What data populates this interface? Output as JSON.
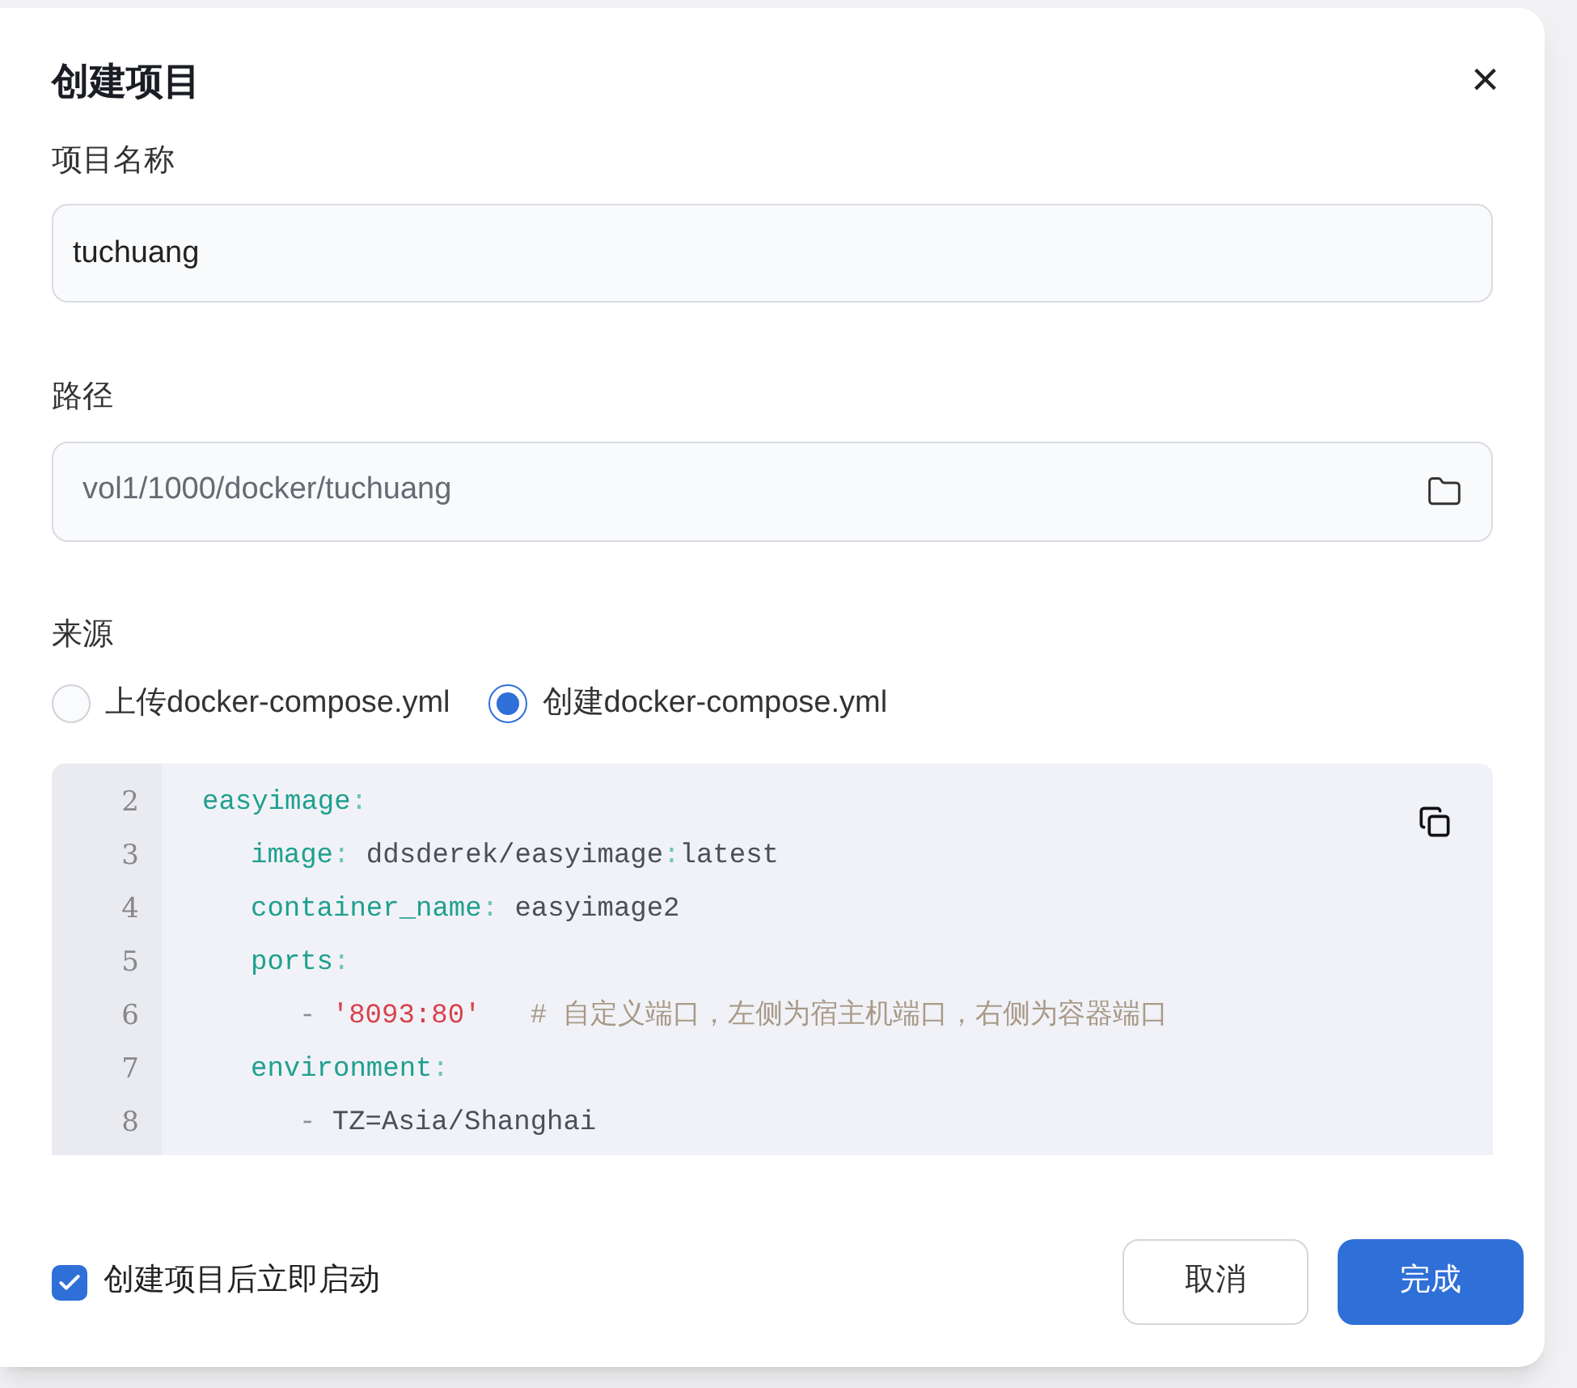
{
  "dialog": {
    "title": "创建项目",
    "close": "×"
  },
  "name_field": {
    "label": "项目名称",
    "value": "tuchuang"
  },
  "path_field": {
    "label": "路径",
    "value": "vol1/1000/docker/tuchuang"
  },
  "source": {
    "label": "来源",
    "options": [
      {
        "label": "上传docker-compose.yml",
        "selected": false
      },
      {
        "label": "创建docker-compose.yml",
        "selected": true
      }
    ]
  },
  "code": {
    "lines": [
      {
        "number": "2",
        "tokens": [
          {
            "kind": "key",
            "text": "easyimage"
          },
          {
            "kind": "punct",
            "text": ":"
          }
        ],
        "children": [
          {
            "number": "3",
            "tokens": [
              {
                "kind": "key",
                "text": "image"
              },
              {
                "kind": "punct",
                "text": ": "
              },
              {
                "kind": "value",
                "text": "ddsderek/easyimage"
              },
              {
                "kind": "punct",
                "text": ":"
              },
              {
                "kind": "value",
                "text": "latest"
              }
            ]
          },
          {
            "number": "4",
            "tokens": [
              {
                "kind": "key",
                "text": "container_name"
              },
              {
                "kind": "punct",
                "text": ": "
              },
              {
                "kind": "value",
                "text": "easyimage2"
              }
            ]
          },
          {
            "number": "5",
            "tokens": [
              {
                "kind": "key",
                "text": "ports"
              },
              {
                "kind": "punct",
                "text": ":"
              }
            ],
            "children": [
              {
                "number": "6",
                "tokens": [
                  {
                    "kind": "dash",
                    "text": "- "
                  },
                  {
                    "kind": "string",
                    "text": "'8093:80'"
                  },
                  {
                    "kind": "comment",
                    "text": "   # 自定义端口，左侧为宿主机端口，右侧为容器端口"
                  }
                ]
              }
            ]
          },
          {
            "number": "7",
            "tokens": [
              {
                "kind": "key",
                "text": "environment"
              },
              {
                "kind": "punct",
                "text": ":"
              }
            ],
            "children": [
              {
                "number": "8",
                "tokens": [
                  {
                    "kind": "dash",
                    "text": "- "
                  },
                  {
                    "kind": "value",
                    "text": "TZ=Asia/Shanghai"
                  }
                ]
              }
            ]
          }
        ]
      }
    ]
  },
  "autostart": {
    "label": "创建项目后立即启动",
    "checked": true
  },
  "buttons": [
    {
      "kind": "secondary",
      "label": "取消"
    },
    {
      "kind": "primary",
      "label": "完成"
    }
  ]
}
